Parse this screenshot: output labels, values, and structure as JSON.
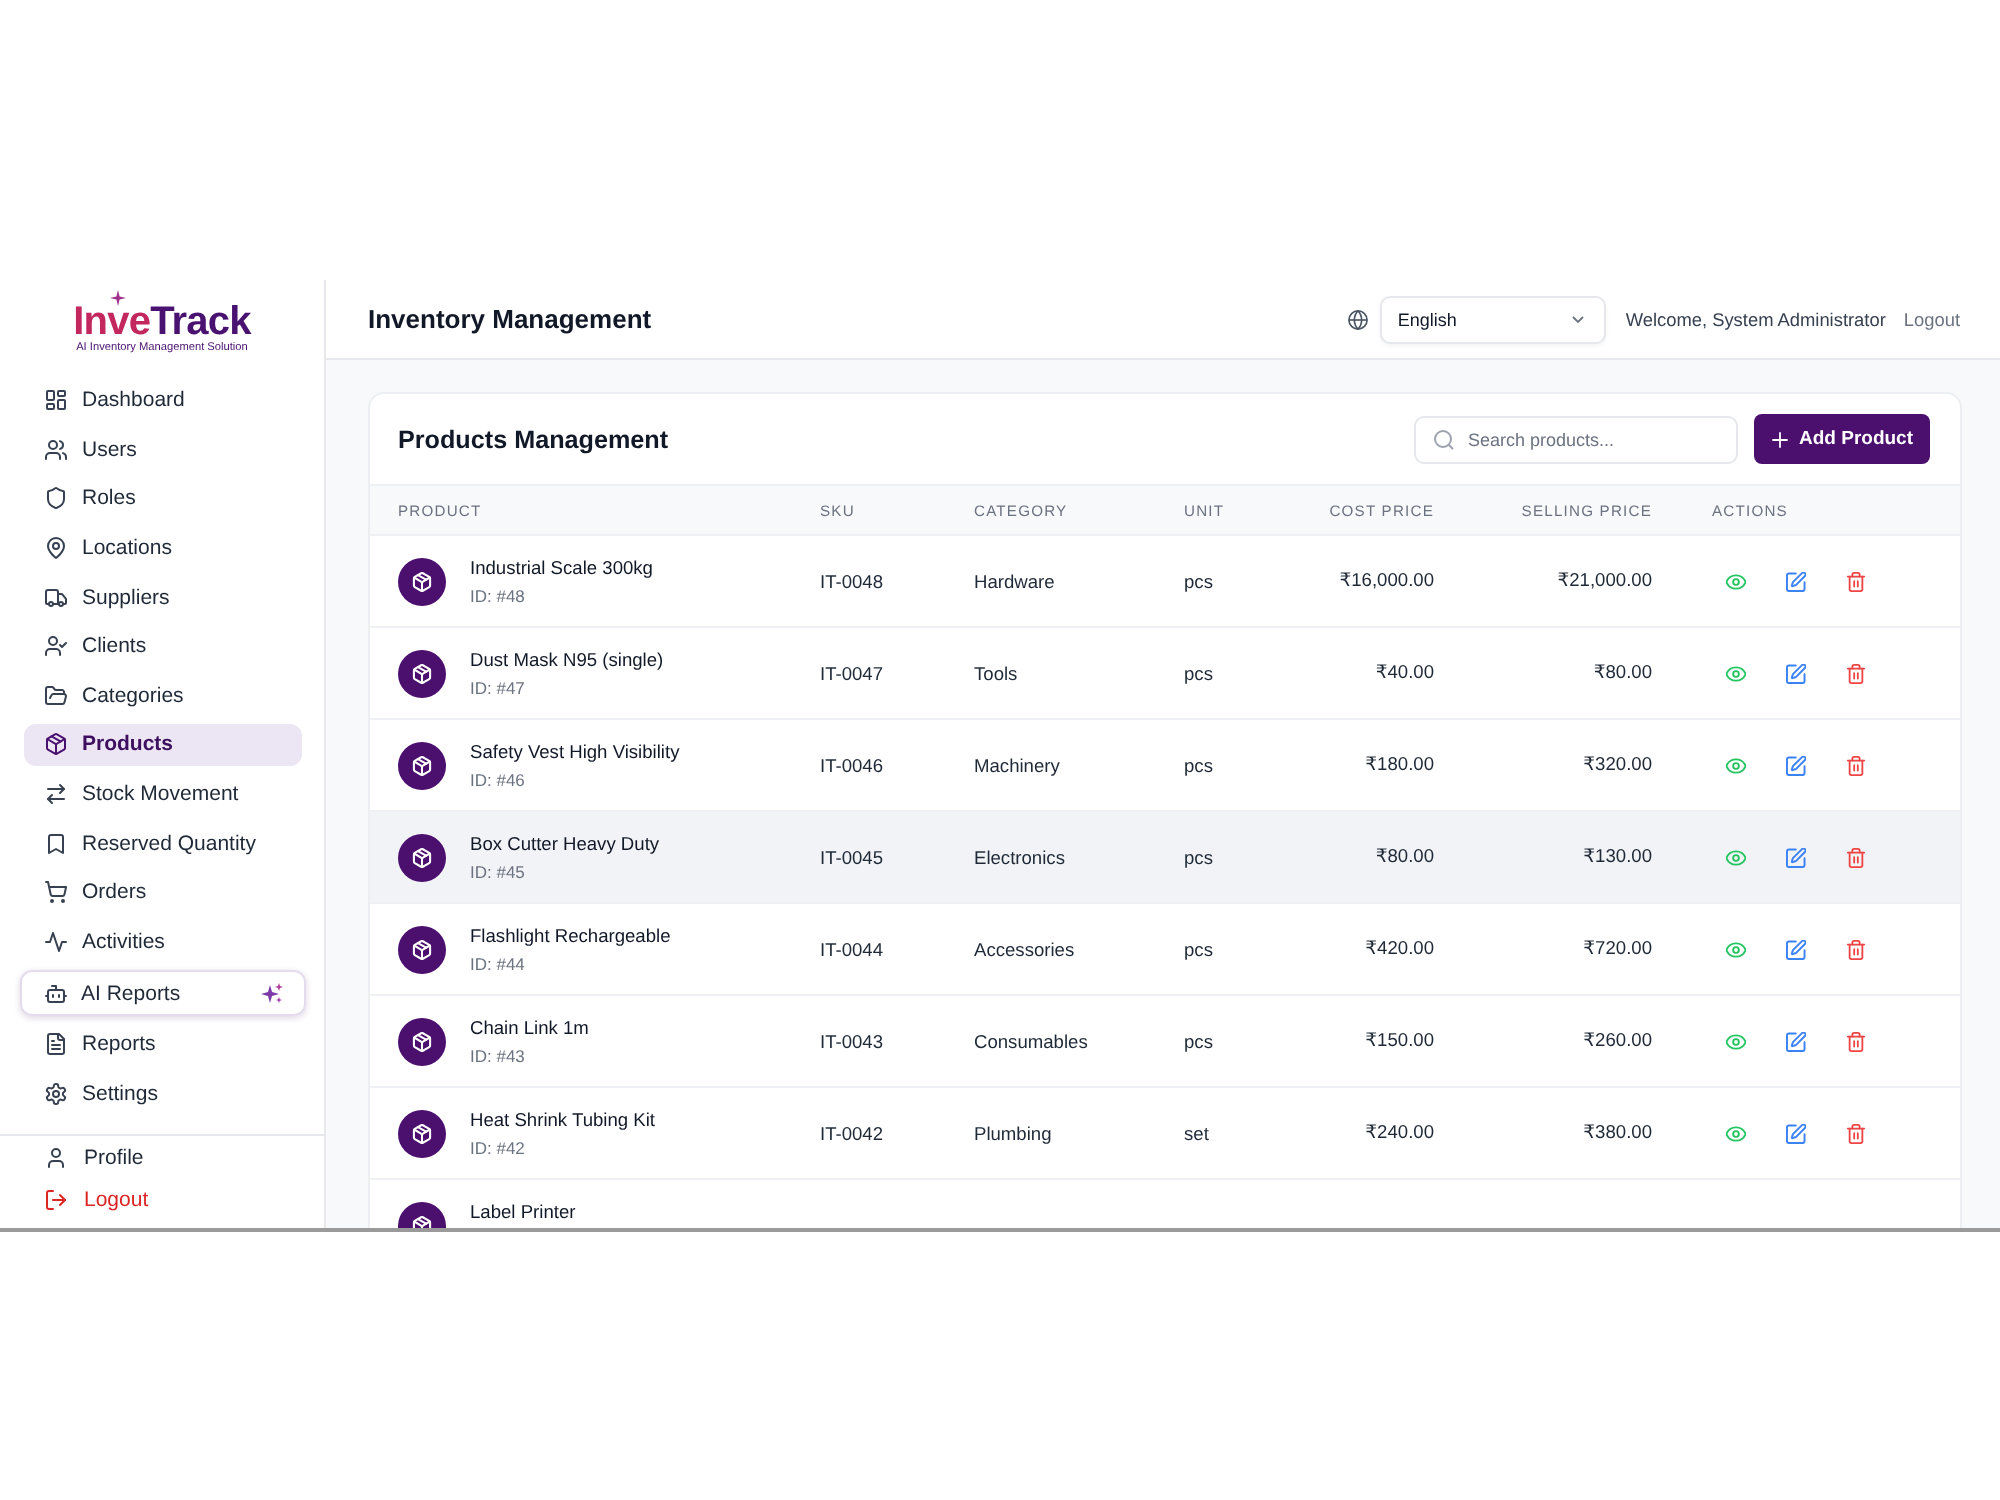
{
  "logo": {
    "parts": [
      "Inve",
      "Track"
    ],
    "tagline": "AI Inventory Management Solution"
  },
  "sidebar": {
    "items": [
      {
        "label": "Dashboard",
        "kind": "link",
        "selected": false
      },
      {
        "label": "Users",
        "kind": "link",
        "selected": false
      },
      {
        "label": "Roles",
        "kind": "link",
        "selected": false
      },
      {
        "label": "Locations",
        "kind": "link",
        "selected": false
      },
      {
        "label": "Suppliers",
        "kind": "link",
        "selected": false
      },
      {
        "label": "Clients",
        "kind": "link",
        "selected": false
      },
      {
        "label": "Categories",
        "kind": "link",
        "selected": false
      },
      {
        "label": "Products",
        "kind": "link",
        "selected": true
      },
      {
        "label": "Stock Movement",
        "kind": "link",
        "selected": false
      },
      {
        "label": "Reserved Quantity",
        "kind": "link",
        "selected": false
      },
      {
        "label": "Orders",
        "kind": "link",
        "selected": false
      },
      {
        "label": "Activities",
        "kind": "link",
        "selected": false
      },
      {
        "label": "AI Reports",
        "kind": "featured",
        "selected": false
      },
      {
        "label": "Reports",
        "kind": "link",
        "selected": false
      },
      {
        "label": "Settings",
        "kind": "link",
        "selected": false
      }
    ],
    "footer": [
      {
        "label": "Profile",
        "kind": "link"
      },
      {
        "label": "Logout",
        "kind": "danger"
      }
    ]
  },
  "header": {
    "title": "Inventory Management",
    "language": {
      "value": "English"
    },
    "welcome": "Welcome, System Administrator",
    "logout": "Logout"
  },
  "products": {
    "title": "Products Management",
    "search": {
      "placeholder": "Search products..."
    },
    "add_button": "Add Product",
    "columns": [
      "PRODUCT",
      "SKU",
      "CATEGORY",
      "UNIT",
      "COST PRICE",
      "SELLING PRICE",
      "ACTIONS"
    ],
    "rows": [
      {
        "name": "Industrial Scale 300kg",
        "id": "ID: #48",
        "sku": "IT-0048",
        "category": "Hardware",
        "unit": "pcs",
        "cost_price": "₹16,000.00",
        "selling_price": "₹21,000.00",
        "highlighted": false
      },
      {
        "name": "Dust Mask N95 (single)",
        "id": "ID: #47",
        "sku": "IT-0047",
        "category": "Tools",
        "unit": "pcs",
        "cost_price": "₹40.00",
        "selling_price": "₹80.00",
        "highlighted": false
      },
      {
        "name": "Safety Vest High Visibility",
        "id": "ID: #46",
        "sku": "IT-0046",
        "category": "Machinery",
        "unit": "pcs",
        "cost_price": "₹180.00",
        "selling_price": "₹320.00",
        "highlighted": false
      },
      {
        "name": "Box Cutter Heavy Duty",
        "id": "ID: #45",
        "sku": "IT-0045",
        "category": "Electronics",
        "unit": "pcs",
        "cost_price": "₹80.00",
        "selling_price": "₹130.00",
        "highlighted": true
      },
      {
        "name": "Flashlight Rechargeable",
        "id": "ID: #44",
        "sku": "IT-0044",
        "category": "Accessories",
        "unit": "pcs",
        "cost_price": "₹420.00",
        "selling_price": "₹720.00",
        "highlighted": false
      },
      {
        "name": "Chain Link 1m",
        "id": "ID: #43",
        "sku": "IT-0043",
        "category": "Consumables",
        "unit": "pcs",
        "cost_price": "₹150.00",
        "selling_price": "₹260.00",
        "highlighted": false
      },
      {
        "name": "Heat Shrink Tubing Kit",
        "id": "ID: #42",
        "sku": "IT-0042",
        "category": "Plumbing",
        "unit": "set",
        "cost_price": "₹240.00",
        "selling_price": "₹380.00",
        "highlighted": false
      },
      {
        "name": "Label Printer",
        "highlighted": false
      }
    ]
  }
}
